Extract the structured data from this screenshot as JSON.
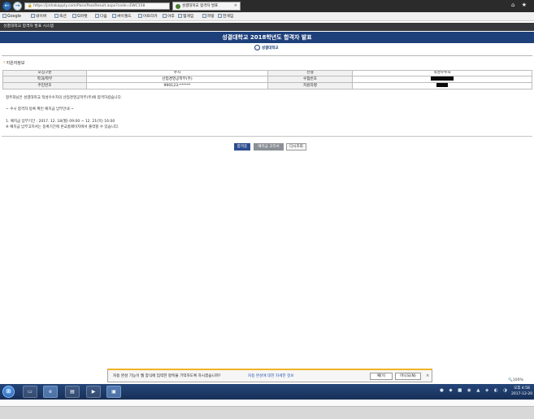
{
  "browser": {
    "url": "https://jinhakapply.com/Pass/PassResult.aspx?code=EWC158",
    "tab_title": "성결대학교 합격자 발표",
    "tab_close": "×",
    "nav_back": "←",
    "nav_forward": "→",
    "lock": "🔒",
    "chrome_icons": "⌂ ★",
    "favorites": [
      {
        "label": "Google"
      },
      {
        "label": "네이버"
      },
      {
        "label": "옥션"
      },
      {
        "label": "G마켓"
      },
      {
        "label": "다음"
      },
      {
        "label": "싸이월드"
      },
      {
        "label": "아프리카"
      },
      {
        "label": "야후"
      },
      {
        "label": "엠게임"
      },
      {
        "label": "파랑"
      },
      {
        "label": "한게임"
      }
    ]
  },
  "page": {
    "system_title": "성결대학교 합격자 발표 시스템",
    "banner_title": "성결대학교 2018학년도 합격자 발표",
    "logo_text": "성결대학교",
    "section_title": "지원자정보",
    "section_bullet": "*",
    "table": {
      "rows": [
        [
          "모집구분",
          "수시",
          "전형",
          "적성우수자"
        ],
        [
          "학과/학부",
          "산업경영공학부(주)",
          "수험번호",
          ""
        ],
        [
          "주민번호",
          "990123-******",
          "지원자명",
          ""
        ]
      ]
    },
    "message_lines": [
      "정주희님은 성결대학교 적성우수자의 산업경영공학부(주)에 합격하셨습니다.",
      "",
      "~ 수시 합격자 등록 확인 예치금 납부안내 ~",
      "",
      "1. 예치금 납부기간 : 2017. 12. 18(월) 09:00 ~ 12. 21(목) 16:00",
      "※ 예치금 납부고지서는 등록기간에 본교홈페이지에서 출력할 수 있습니다."
    ],
    "buttons": {
      "pass_cert": "합격증",
      "deposit_notice": "예치금 고지서",
      "re_search": "다시조회"
    }
  },
  "notification": {
    "message": "자동 완성 기능이 웹 양식에 입력한 항목을 기억하도록 하시겠습니까?",
    "link": "자동 완성에 대한 자세한 정보",
    "yes": "예(Y)",
    "no": "아니요(N)",
    "close": "×"
  },
  "zoom": "100%",
  "taskbar": {
    "start_icon": "⊞",
    "apps": [
      {
        "name": "windows-explorer",
        "glyph": "▭"
      },
      {
        "name": "internet-explorer",
        "glyph": "e"
      },
      {
        "name": "file-explorer",
        "glyph": "▤"
      },
      {
        "name": "media-player",
        "glyph": "▶"
      },
      {
        "name": "active-window",
        "glyph": "▣"
      }
    ],
    "tray_icons": "● ◆ ■ ◉ ▲ ◈ ◐ ◑",
    "time": "오후 4:58",
    "date": "2017-12-20"
  }
}
